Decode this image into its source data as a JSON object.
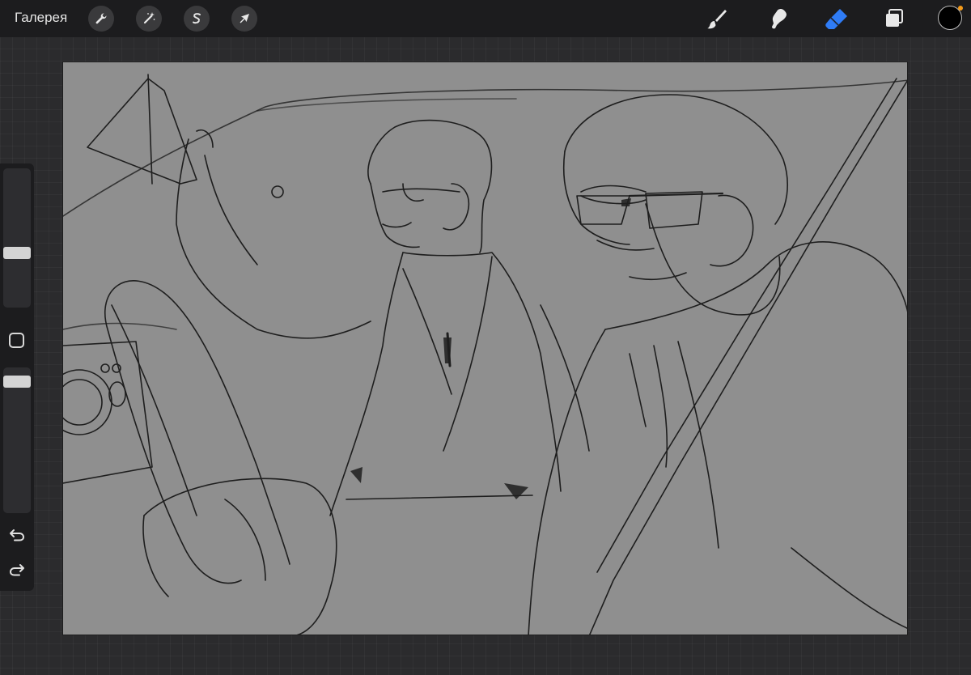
{
  "toolbar": {
    "gallery_label": "Галерея",
    "left_tools": [
      {
        "name": "actions",
        "icon": "wrench-icon"
      },
      {
        "name": "adjustments",
        "icon": "magic-wand-icon"
      },
      {
        "name": "selection",
        "icon": "selection-s-icon"
      },
      {
        "name": "transform",
        "icon": "arrow-cursor-icon"
      }
    ],
    "right_tools": [
      {
        "name": "brush",
        "icon": "brush-icon",
        "active": false
      },
      {
        "name": "smudge",
        "icon": "smudge-finger-icon",
        "active": false
      },
      {
        "name": "eraser",
        "icon": "eraser-icon",
        "active": true
      },
      {
        "name": "layers",
        "icon": "layers-icon",
        "active": false
      }
    ],
    "current_color": "#000000",
    "accent_color": "#2f7cf6"
  },
  "sidebar": {
    "brush_size_level": 0.45,
    "opacity_level": 0.9,
    "icons": [
      "modify-square-icon",
      "undo-icon",
      "redo-icon"
    ]
  },
  "canvas": {
    "background_color": "#8f8f8f",
    "content": "sketch-artwork"
  }
}
